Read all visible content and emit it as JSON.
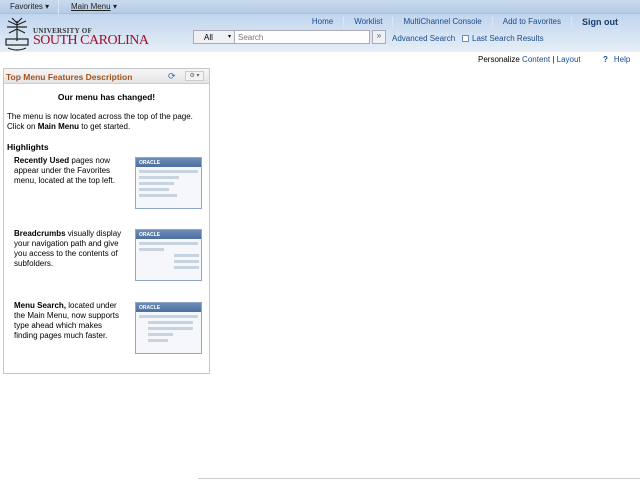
{
  "topbar": {
    "favorites": "Favorites ▾",
    "main_menu": "Main Menu",
    "main_menu_arrow": "▾"
  },
  "header": {
    "logo_line1": "UNIVERSITY OF",
    "logo_line2": "SOUTH CAROLINA",
    "links": [
      "Home",
      "Worklist",
      "MultiChannel Console",
      "Add to Favorites"
    ],
    "sign_out": "Sign out"
  },
  "search": {
    "scope": "All",
    "scope_arrow": "▾",
    "placeholder": "Search",
    "go": "»",
    "advanced": "Advanced Search",
    "last_results": "Last Search Results"
  },
  "personalize": {
    "label": "Personalize",
    "content": "Content",
    "sep": "|",
    "layout": "Layout",
    "help_icon": "?",
    "help": "Help"
  },
  "panel": {
    "title": "Top Menu Features Description",
    "refresh_icon": "⟳",
    "gear_icon": "⚙ ▾",
    "heading": "Our menu has changed!",
    "intro_pre": "The menu is now located across the top of the page. Click on ",
    "intro_bold": "Main Menu",
    "intro_post": " to get started.",
    "highlights": "Highlights",
    "features": [
      {
        "bold": "Recently Used",
        "text": " pages now appear under the Favorites menu, located at the top left.",
        "image_label": "ORACLE"
      },
      {
        "bold": "Breadcrumbs",
        "text": " visually display your navigation path and give you access to the contents of subfolders.",
        "image_label": "ORACLE"
      },
      {
        "bold": "Menu Search,",
        "text": " located under the Main Menu, now supports type ahead which makes finding pages much faster.",
        "image_label": "ORACLE"
      }
    ]
  },
  "colors": {
    "brand": "#a0112b",
    "panel_title": "#a4531d",
    "link": "#1a4b8c"
  }
}
